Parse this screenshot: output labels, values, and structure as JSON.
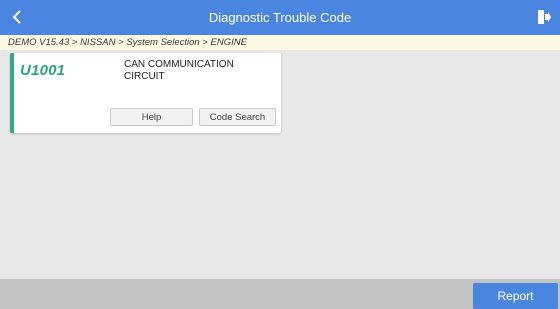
{
  "header": {
    "title": "Diagnostic Trouble Code",
    "back_icon": "chevron-left-icon",
    "exit_icon": "exit-icon",
    "color": "#4a86e0"
  },
  "breadcrumb": {
    "text": "DEMO V15.43 > NISSAN > System Selection > ENGINE"
  },
  "dtc_list": [
    {
      "code": "U1001",
      "description": "CAN COMMUNICATION CIRCUIT",
      "help_label": "Help",
      "code_search_label": "Code Search",
      "accent_color": "#2eaa88"
    }
  ],
  "footer": {
    "report_label": "Report"
  }
}
